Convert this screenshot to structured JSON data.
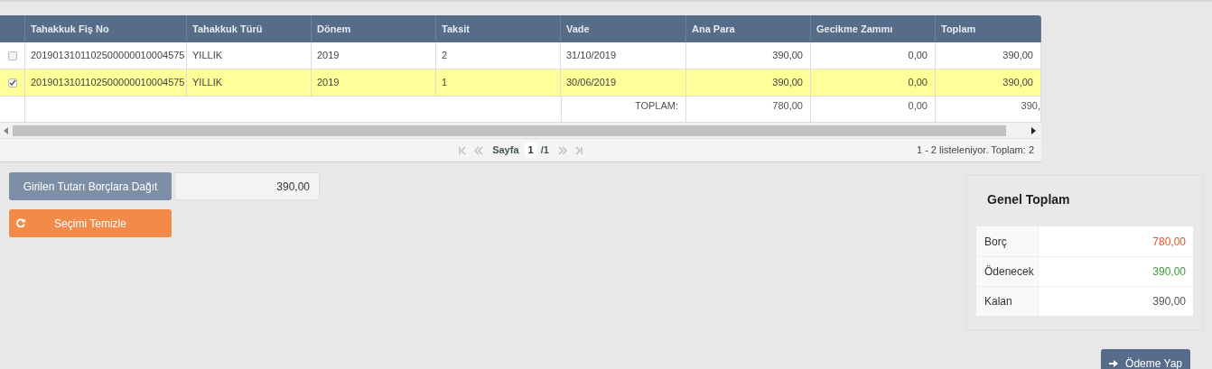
{
  "table": {
    "columns": [
      "Tahakkuk Fiş No",
      "Tahakkuk Türü",
      "Dönem",
      "Taksit",
      "Vade",
      "Ana Para",
      "Gecikme Zammı",
      "Toplam"
    ],
    "rows": [
      {
        "selected": false,
        "cells": [
          "2019013101102500000010004575",
          "YILLIK",
          "2019",
          "2",
          "31/10/2019",
          "390,00",
          "0,00",
          "390,00"
        ]
      },
      {
        "selected": true,
        "cells": [
          "2019013101102500000010004575",
          "YILLIK",
          "2019",
          "1",
          "30/06/2019",
          "390,00",
          "0,00",
          "390,00"
        ]
      }
    ],
    "footer": {
      "label": "TOPLAM:",
      "ana_para": "780,00",
      "gecikme_zammi": "0,00",
      "toplam": "390,"
    }
  },
  "pager": {
    "label": "Sayfa",
    "page": "1",
    "of": "/1",
    "summary": "1 - 2 listeleniyor. Toplam: 2"
  },
  "distribute_button": "Girilen Tutarı Borçlara Dağıt",
  "amount_field": {
    "value": "390,00"
  },
  "clear_button": "Seçimi Temizle",
  "summary": {
    "title": "Genel Toplam",
    "items": [
      {
        "label": "Borç",
        "value": "780,00",
        "color": "#e0562a"
      },
      {
        "label": "Ödenecek",
        "value": "390,00",
        "color": "#3d9a3d"
      },
      {
        "label": "Kalan",
        "value": "390,00",
        "color": "#555555"
      }
    ]
  },
  "pay_button": "Ödeme Yap"
}
